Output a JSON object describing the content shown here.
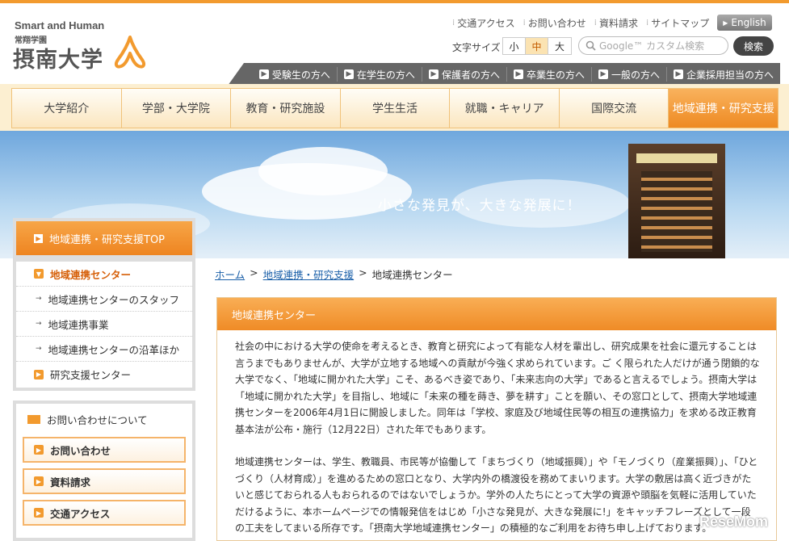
{
  "header": {
    "logo_en": "Smart and Human",
    "logo_sub": "常翔学園",
    "logo_jp": "摂南大学",
    "utility_links": [
      "交通アクセス",
      "お問い合わせ",
      "資料請求",
      "サイトマップ"
    ],
    "english_button": "English",
    "font_size_label": "文字サイズ",
    "font_sizes": [
      "小",
      "中",
      "大"
    ],
    "search_placeholder": "Google™ カスタム検索",
    "search_button": "検索"
  },
  "audience_nav": [
    "受験生の方へ",
    "在学生の方へ",
    "保護者の方へ",
    "卒業生の方へ",
    "一般の方へ",
    "企業採用担当の方へ"
  ],
  "global_nav": [
    "大学紹介",
    "学部・大学院",
    "教育・研究施設",
    "学生生活",
    "就職・キャリア",
    "国際交流",
    "地域連携・研究支援"
  ],
  "hero": {
    "tagline": "小さな発見が、大きな発展に！"
  },
  "sidebar": {
    "top_button": "地域連携・研究支援TOP",
    "menu": [
      {
        "label": "地域連携センター",
        "level": "top",
        "active": true
      },
      {
        "label": "地域連携センターのスタッフ",
        "level": "sub"
      },
      {
        "label": "地域連携事業",
        "level": "sub"
      },
      {
        "label": "地域連携センターの沿革ほか",
        "level": "sub"
      },
      {
        "label": "研究支援センター",
        "level": "top"
      }
    ],
    "contact_title": "お問い合わせについて",
    "contact_buttons": [
      "お問い合わせ",
      "資料請求",
      "交通アクセス"
    ]
  },
  "breadcrumb": {
    "home": "ホーム",
    "section": "地域連携・研究支援",
    "current": "地域連携センター",
    "separator": ">"
  },
  "content": {
    "heading": "地域連携センター",
    "paragraph1": "社会の中における大学の使命を考えるとき、教育と研究によって有能な人材を輩出し、研究成果を社会に還元することは言うまでもありませんが、大学が立地する地域への貢献が今強く求められています。ご く限られた人だけが通う閉鎖的な大学でなく、「地域に開かれた大学」こそ、あるべき姿であり、「未来志向の大学」であると言えるでしょう。摂南大学は「地域に開かれた大学」を目指し、地域に「未来の種を蒔き、夢を耕す」ことを願い、その窓口として、摂南大学地域連携センターを2006年4月1日に開設しました。同年は「学校、家庭及び地域住民等の相互の連携協力」を求める改正教育基本法が公布・施行（12月22日）された年でもあります。",
    "paragraph2": "地域連携センターは、学生、教職員、市民等が協働して「まちづくり（地域振興）」や「モノづくり（産業振興）」、「ひとづくり（人材育成）」を進めるための窓口となり、大学内外の橋渡役を務めてまいります。大学の敷居は高く近づきがたいと感じておられる人もおられるのではないでしょうか。学外の人たちにとって大学の資源や頭脳を気軽に活用していただけるように、本ホームページでの情報発信をはじめ「小さな発見が、大きな発展に!」をキャッチフレーズとして一段の工夫をしてまいる所存です。「摂南大学地域連携センター」の積極的なご利用をお待ち申し上げております。"
  },
  "watermark": "ReseMom",
  "colors": {
    "accent_orange": "#ee8a22",
    "link_blue": "#1a5fa8",
    "audience_bar": "#666666"
  }
}
